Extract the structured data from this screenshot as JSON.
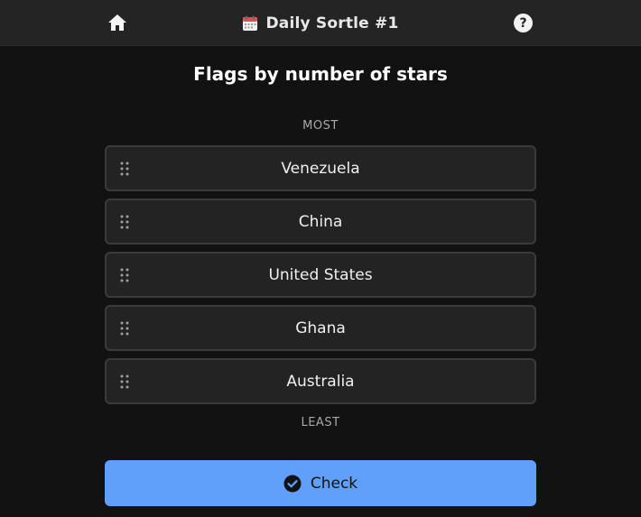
{
  "header": {
    "title": "Daily Sortle #1",
    "home_icon": "home-icon",
    "calendar_icon": "calendar-icon",
    "help_label": "?"
  },
  "puzzle": {
    "title": "Flags by number of stars",
    "top_hint": "MOST",
    "bottom_hint": "LEAST",
    "items": [
      {
        "label": "Venezuela"
      },
      {
        "label": "China"
      },
      {
        "label": "United States"
      },
      {
        "label": "Ghana"
      },
      {
        "label": "Australia"
      }
    ]
  },
  "actions": {
    "check_label": "Check"
  },
  "colors": {
    "background": "#121212",
    "topbar": "#242424",
    "item_bg": "#232323",
    "item_border": "#3b3b3b",
    "accent": "#60a0fb"
  }
}
